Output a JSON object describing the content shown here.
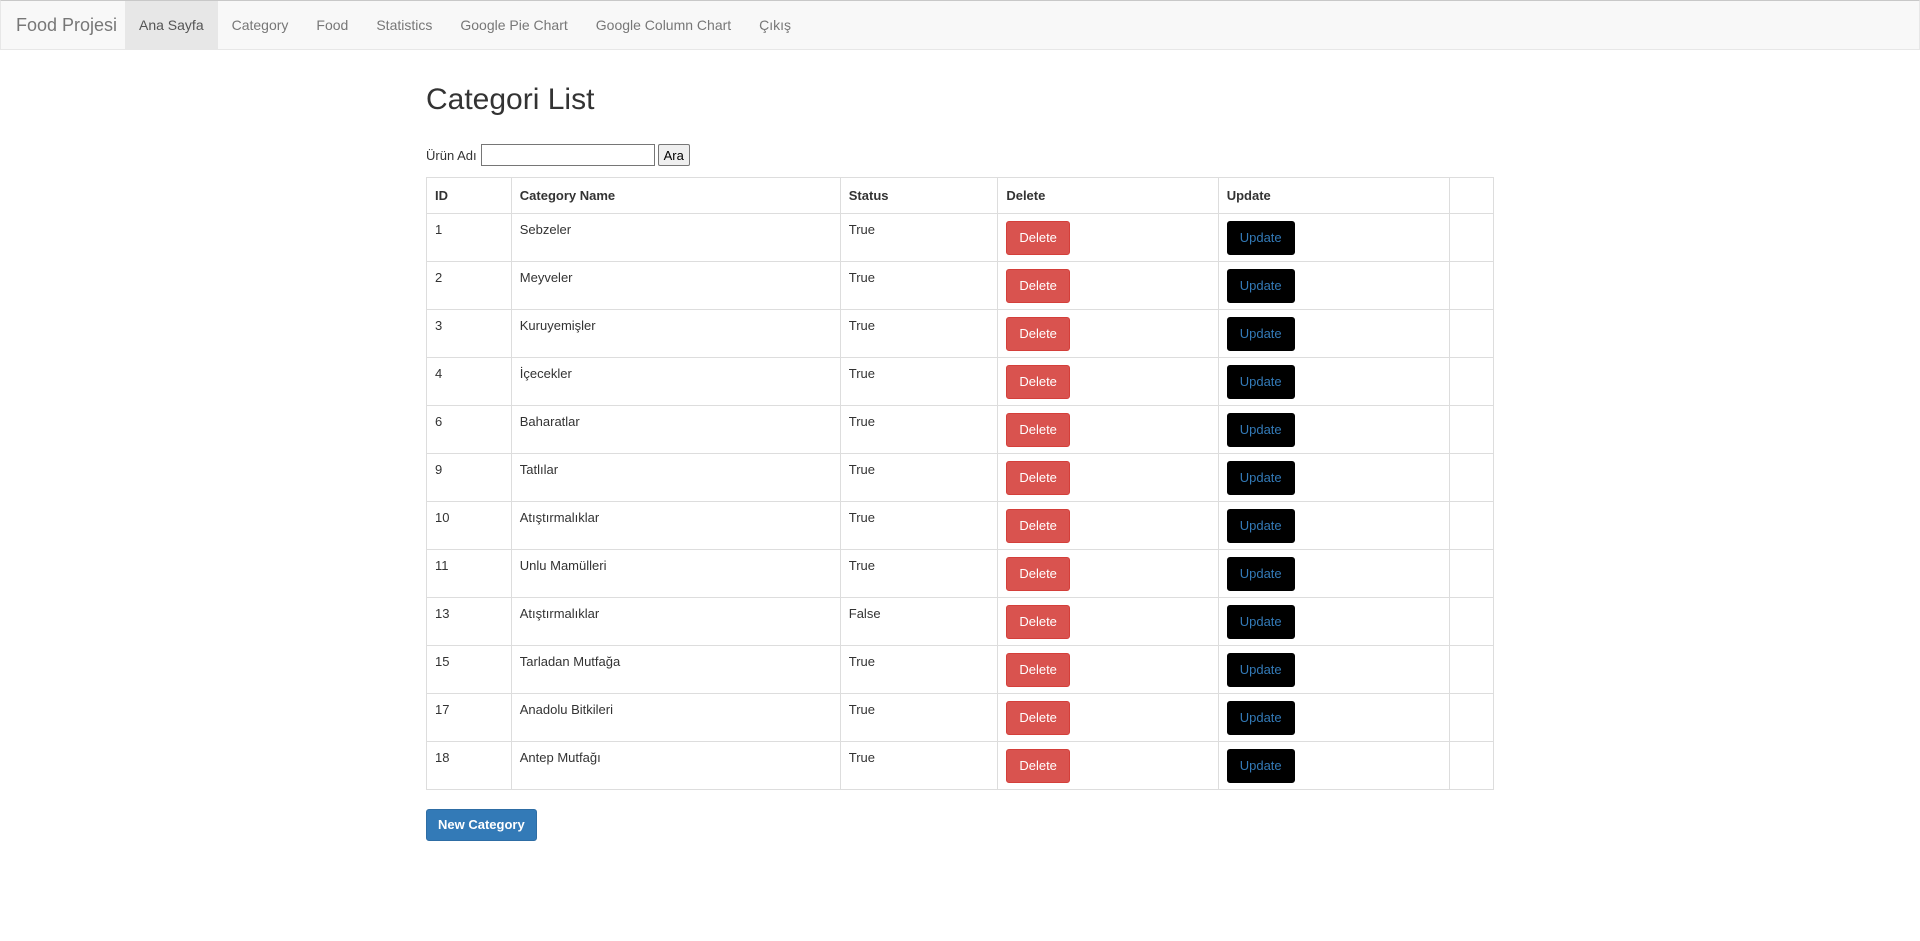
{
  "navbar": {
    "brand": "Food Projesi",
    "items": [
      {
        "label": "Ana Sayfa",
        "active": true
      },
      {
        "label": "Category",
        "active": false
      },
      {
        "label": "Food",
        "active": false
      },
      {
        "label": "Statistics",
        "active": false
      },
      {
        "label": "Google Pie Chart",
        "active": false
      },
      {
        "label": "Google Column Chart",
        "active": false
      },
      {
        "label": "Çıkış",
        "active": false
      }
    ]
  },
  "page": {
    "title": "Categori List"
  },
  "search": {
    "label": "Ürün Adı",
    "value": "",
    "button_label": "Ara"
  },
  "table": {
    "headers": [
      "ID",
      "Category Name",
      "Status",
      "Delete",
      "Update",
      ""
    ],
    "rows": [
      {
        "id": "1",
        "name": "Sebzeler",
        "status": "True"
      },
      {
        "id": "2",
        "name": "Meyveler",
        "status": "True"
      },
      {
        "id": "3",
        "name": "Kuruyemişler",
        "status": "True"
      },
      {
        "id": "4",
        "name": "İçecekler",
        "status": "True"
      },
      {
        "id": "6",
        "name": "Baharatlar",
        "status": "True"
      },
      {
        "id": "9",
        "name": "Tatlılar",
        "status": "True"
      },
      {
        "id": "10",
        "name": "Atıştırmalıklar",
        "status": "True"
      },
      {
        "id": "11",
        "name": "Unlu Mamülleri",
        "status": "True"
      },
      {
        "id": "13",
        "name": "Atıştırmalıklar",
        "status": "False"
      },
      {
        "id": "15",
        "name": "Tarladan Mutfağa",
        "status": "True"
      },
      {
        "id": "17",
        "name": "Anadolu Bitkileri",
        "status": "True"
      },
      {
        "id": "18",
        "name": "Antep Mutfağı",
        "status": "True"
      }
    ],
    "delete_label": "Delete",
    "update_label": "Update"
  },
  "actions": {
    "new_category_label": "New Category"
  },
  "colors": {
    "danger": "#d9534f",
    "primary": "#337ab7",
    "update_bg": "#000000",
    "navbar_bg": "#f8f8f8"
  }
}
